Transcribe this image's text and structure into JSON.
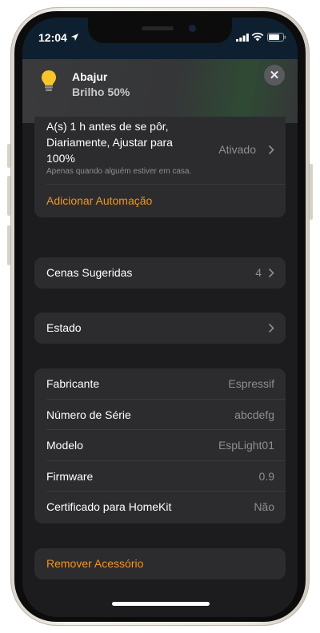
{
  "status_bar": {
    "time": "12:04"
  },
  "accessory": {
    "name": "Abajur",
    "status": "Brilho 50%"
  },
  "automation": {
    "line1": "A(s) 1 h antes de se pôr,",
    "line2": "Diariamente, Ajustar para",
    "line3": "100%",
    "state": "Ativado",
    "note": "Apenas quando alguém estiver em casa.",
    "add_label": "Adicionar Automação"
  },
  "scenes": {
    "label": "Cenas Sugeridas",
    "count": "4"
  },
  "state_row": {
    "label": "Estado"
  },
  "info": [
    {
      "label": "Fabricante",
      "value": "Espressif"
    },
    {
      "label": "Número de Série",
      "value": "abcdefg"
    },
    {
      "label": "Modelo",
      "value": "EspLight01"
    },
    {
      "label": "Firmware",
      "value": "0.9"
    },
    {
      "label": "Certificado para HomeKit",
      "value": "Não"
    }
  ],
  "remove_label": "Remover Acessório",
  "colors": {
    "accent": "#f5951f",
    "background": "#1c1c1e",
    "card": "#2c2c2e"
  }
}
